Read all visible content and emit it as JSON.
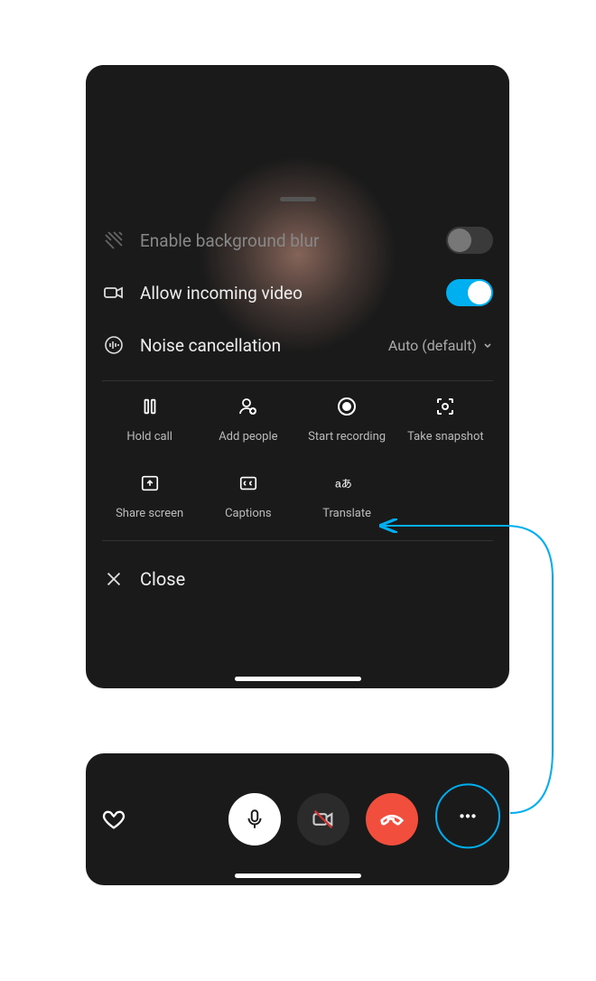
{
  "settings": {
    "blur": {
      "label": "Enable background blur",
      "on": false
    },
    "incoming": {
      "label": "Allow incoming video",
      "on": true
    },
    "noise": {
      "label": "Noise cancellation",
      "value": "Auto (default)"
    }
  },
  "actions": {
    "hold": "Hold call",
    "add": "Add people",
    "record": "Start recording",
    "snapshot": "Take snapshot",
    "share": "Share screen",
    "captions": "Captions",
    "translate": "Translate"
  },
  "close": {
    "label": "Close"
  }
}
